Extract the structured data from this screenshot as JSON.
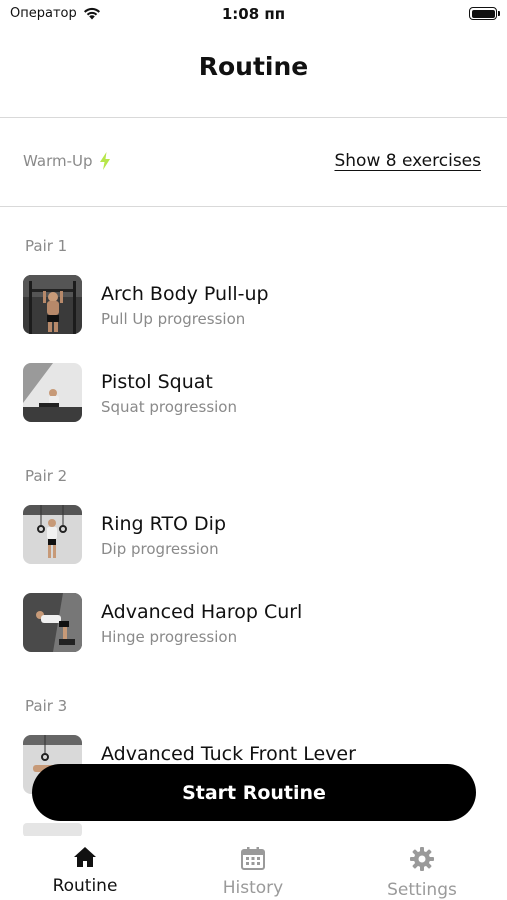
{
  "status_bar": {
    "carrier": "Оператор",
    "time": "1:08 пп"
  },
  "header": {
    "title": "Routine"
  },
  "warmup": {
    "label": "Warm-Up",
    "link": "Show 8 exercises"
  },
  "pairs": [
    {
      "label": "Pair 1",
      "exercises": [
        {
          "name": "Arch Body Pull-up",
          "progression": "Pull Up progression"
        },
        {
          "name": "Pistol Squat",
          "progression": "Squat progression"
        }
      ]
    },
    {
      "label": "Pair 2",
      "exercises": [
        {
          "name": "Ring RTO Dip",
          "progression": "Dip progression"
        },
        {
          "name": "Advanced Harop Curl",
          "progression": "Hinge progression"
        }
      ]
    },
    {
      "label": "Pair 3",
      "exercises": [
        {
          "name": "Advanced Tuck Front Lever",
          "progression": ""
        }
      ]
    }
  ],
  "start_button": {
    "label": "Start Routine"
  },
  "tabs": [
    {
      "label": "Routine",
      "icon": "home-icon",
      "active": true
    },
    {
      "label": "History",
      "icon": "calendar-icon",
      "active": false
    },
    {
      "label": "Settings",
      "icon": "gear-icon",
      "active": false
    }
  ],
  "colors": {
    "accent_bolt": "#b7e64a",
    "button_bg": "#000000",
    "muted_text": "#8a8a8a"
  }
}
